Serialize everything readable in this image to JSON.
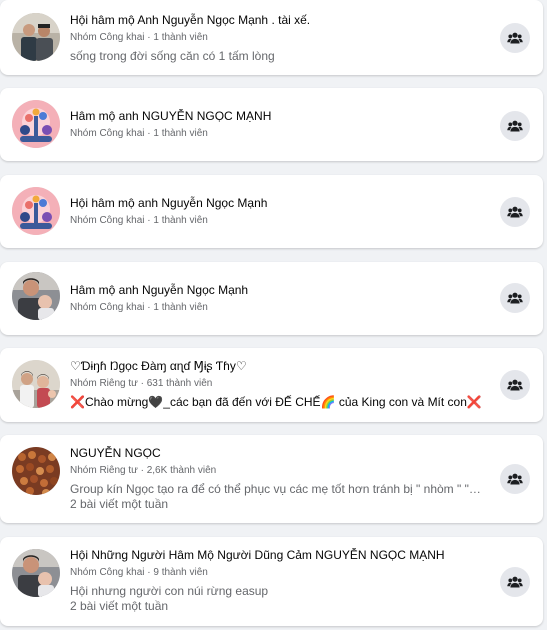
{
  "groups": [
    {
      "name": "Hội hâm mộ Anh Nguyễn Ngọc Mạnh . tài xế.",
      "meta": "Nhóm Công khai · 1 thành viên",
      "description": "sống trong đời sống căn có 1 tấm lòng",
      "activity": "",
      "avatar": "two-men-photo",
      "join_icon": "join-group-icon"
    },
    {
      "name": "Hâm mộ anh NGUYỄN NGỌC MẠNH",
      "meta": "Nhóm Công khai · 1 thành viên",
      "description": "",
      "activity": "",
      "avatar": "default-group-illustration",
      "join_icon": "join-group-icon"
    },
    {
      "name": "Hội hâm mộ anh Nguyễn Ngọc Mạnh",
      "meta": "Nhóm Công khai · 1 thành viên",
      "description": "",
      "activity": "",
      "avatar": "default-group-illustration",
      "join_icon": "join-group-icon"
    },
    {
      "name": "Hâm mộ anh Nguyễn Ngọc Mạnh",
      "meta": "Nhóm Công khai · 1 thành viên",
      "description": "",
      "activity": "",
      "avatar": "man-with-baby-photo",
      "join_icon": "join-group-icon"
    },
    {
      "name": "♡Ɗɨŋɦ Ŋgọc Ɖàɱ αɳɗ Ɱɨʂ Ƭɦy♡",
      "meta": "Nhóm Riêng tư · 631 thành viên",
      "description": "❌Chào mừng🖤_các bạn đã đến với ĐẾ CHẾ🌈 của King con và Mít con❌",
      "activity": "",
      "avatar": "family-photo",
      "join_icon": "join-group-icon"
    },
    {
      "name": "NGUYỄN NGỌC",
      "meta": "Nhóm Riêng tư · 2,6K thành viên",
      "description": "Group kín Ngọc tạo ra để có thể phục vụ các mẹ tốt hơn tránh bị \" nhòm \" \" nhó \"",
      "activity": "2 bài viết một tuần",
      "avatar": "bracelets-photo",
      "join_icon": "join-group-icon"
    },
    {
      "name": "Hội Những Người Hâm Mộ Người Dũng Cảm NGUYỄN NGỌC MẠNH",
      "meta": "Nhóm Công khai · 9 thành viên",
      "description": "Hội nhưng người con núi rừng easup",
      "activity": "2 bài viết một tuần",
      "avatar": "man-with-baby-photo",
      "join_icon": "join-group-icon"
    }
  ]
}
